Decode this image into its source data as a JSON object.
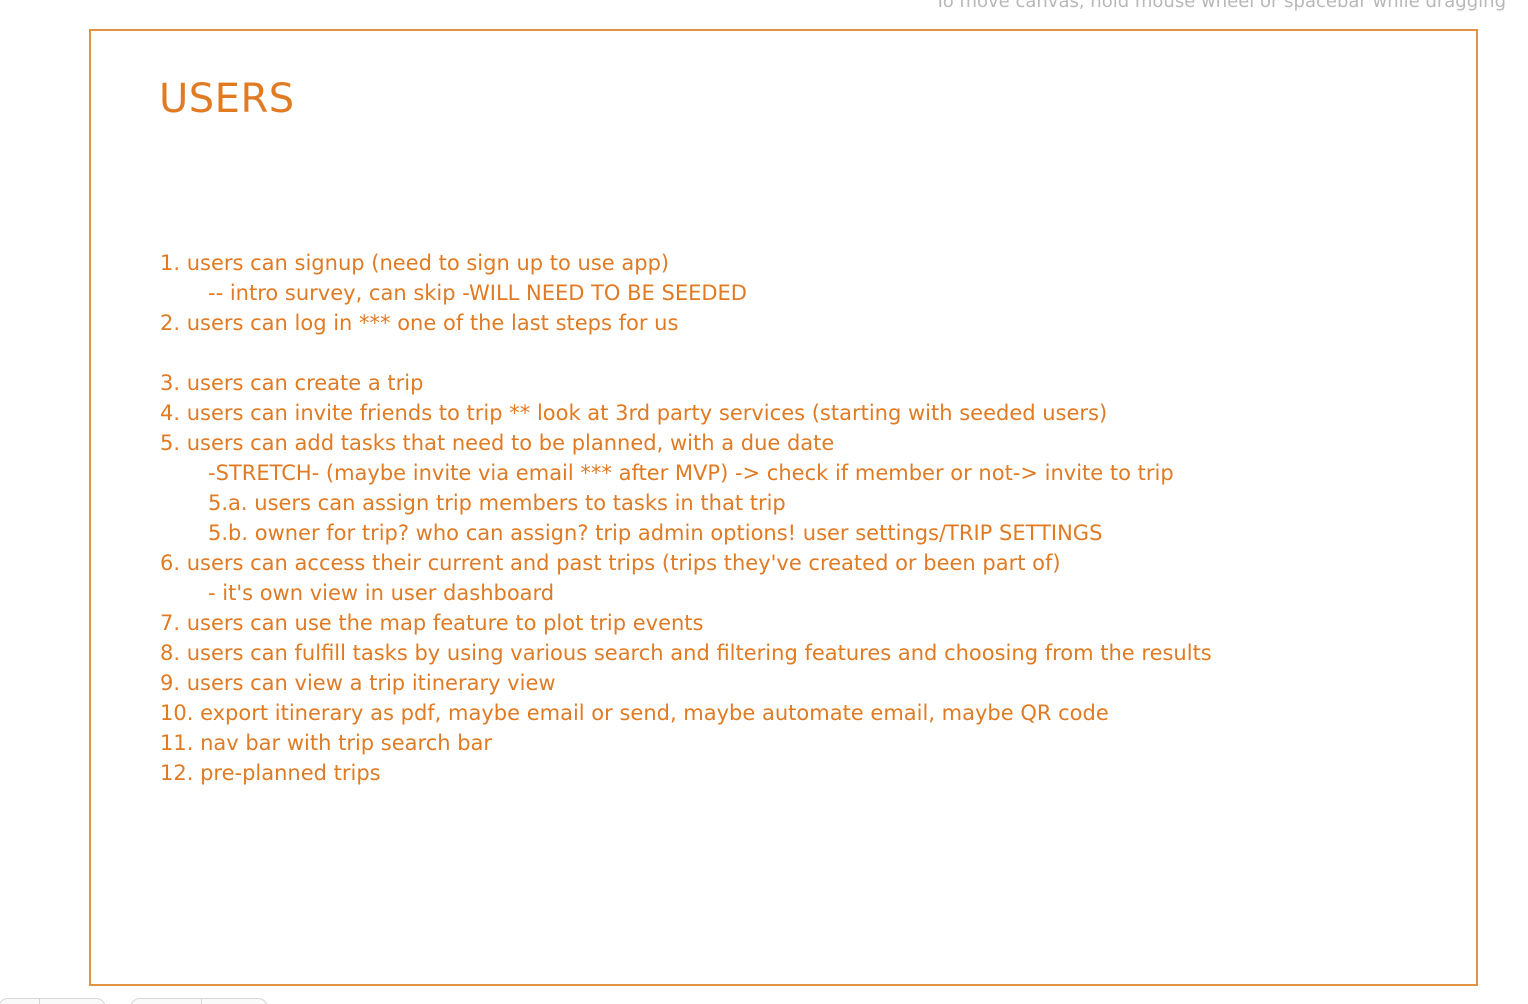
{
  "hint": "To move canvas, hold mouse wheel or spacebar while dragging",
  "frame": {
    "title": "USERS",
    "stroke_color": "#e39244",
    "text_color": "#e07b24",
    "lines": [
      {
        "text": "1. users can signup (need to sign up to use app)",
        "indent": false
      },
      {
        "text": "-- intro survey, can skip -WILL NEED TO BE SEEDED",
        "indent": true
      },
      {
        "text": "2. users can log in *** one of the last steps for us",
        "indent": false
      },
      {
        "text": "",
        "indent": false
      },
      {
        "text": "3. users can create a trip",
        "indent": false
      },
      {
        "text": "4. users can invite friends to trip ** look at 3rd party services (starting with seeded users)",
        "indent": false
      },
      {
        "text": "5. users can add tasks that need to be planned, with a due date",
        "indent": false
      },
      {
        "text": "-STRETCH- (maybe invite via email *** after MVP) -> check if member or not-> invite to trip",
        "indent": true
      },
      {
        "text": "5.a. users can assign trip members to tasks in that trip",
        "indent": true
      },
      {
        "text": "5.b. owner for trip? who can assign? trip admin options! user settings/TRIP SETTINGS",
        "indent": true
      },
      {
        "text": "6. users can access their current and past trips (trips they've created or been part of)",
        "indent": false
      },
      {
        "text": "- it's own view in user dashboard",
        "indent": true
      },
      {
        "text": "7. users can use the map feature to plot trip events",
        "indent": false
      },
      {
        "text": "8. users can fulfill tasks by using various search and filtering features and choosing from the results",
        "indent": false
      },
      {
        "text": "9. users can view a trip itinerary view",
        "indent": false
      },
      {
        "text": "10. export itinerary as pdf, maybe email or send, maybe automate email, maybe QR code",
        "indent": false
      },
      {
        "text": "11. nav bar with trip search bar",
        "indent": false
      },
      {
        "text": "12. pre-planned trips",
        "indent": false
      }
    ]
  }
}
